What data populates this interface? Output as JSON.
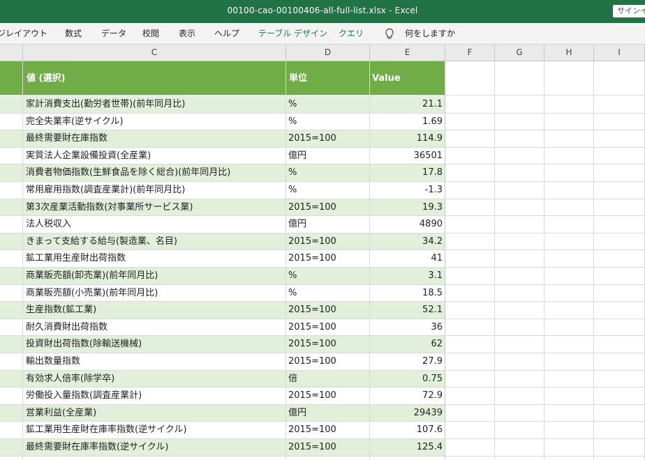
{
  "window": {
    "title": "00100-cao-00100406-all-full-list.xlsx  -  Excel",
    "sign_in": "サインイン"
  },
  "ribbon": {
    "tabs": [
      "ジレイアウト",
      "数式",
      "データ",
      "校閲",
      "表示",
      "ヘルプ",
      "テーブル デザイン",
      "クエリ"
    ],
    "tell_me": "何をしますか"
  },
  "columns": [
    "C",
    "D",
    "E",
    "F",
    "G",
    "H",
    "I"
  ],
  "table": {
    "headers": [
      "値 (選択)",
      "単位",
      "Value"
    ],
    "rows": [
      {
        "name": "家計消費支出(勤労者世帯)(前年同月比)",
        "unit": "%",
        "value": "21.1"
      },
      {
        "name": "完全失業率(逆サイクル)",
        "unit": "%",
        "value": "1.69"
      },
      {
        "name": "最終需要財在庫指数",
        "unit": "2015=100",
        "value": "114.9"
      },
      {
        "name": "実質法人企業設備投資(全産業)",
        "unit": "億円",
        "value": "36501"
      },
      {
        "name": "消費者物価指数(生鮮食品を除く総合)(前年同月比)",
        "unit": "%",
        "value": "17.8"
      },
      {
        "name": "常用雇用指数(調査産業計)(前年同月比)",
        "unit": "%",
        "value": "-1.3"
      },
      {
        "name": "第3次産業活動指数(対事業所サービス業)",
        "unit": "2015=100",
        "value": "19.3"
      },
      {
        "name": "法人税収入",
        "unit": "億円",
        "value": "4890"
      },
      {
        "name": "きまって支給する給与(製造業、名目)",
        "unit": "2015=100",
        "value": "34.2"
      },
      {
        "name": "鉱工業用生産財出荷指数",
        "unit": "2015=100",
        "value": "41"
      },
      {
        "name": "商業販売額(卸売業)(前年同月比)",
        "unit": "%",
        "value": "3.1"
      },
      {
        "name": "商業販売額(小売業)(前年同月比)",
        "unit": "%",
        "value": "18.5"
      },
      {
        "name": "生産指数(鉱工業)",
        "unit": "2015=100",
        "value": "52.1"
      },
      {
        "name": "耐久消費財出荷指数",
        "unit": "2015=100",
        "value": "36"
      },
      {
        "name": "投資財出荷指数(除輸送機械)",
        "unit": "2015=100",
        "value": "62"
      },
      {
        "name": "輸出数量指数",
        "unit": "2015=100",
        "value": "27.9"
      },
      {
        "name": "有効求人倍率(除学卒)",
        "unit": "倍",
        "value": "0.75"
      },
      {
        "name": "労働投入量指数(調査産業計)",
        "unit": "2015=100",
        "value": "72.9"
      },
      {
        "name": "営業利益(全産業)",
        "unit": "億円",
        "value": "29439"
      },
      {
        "name": "鉱工業用生産財在庫率指数(逆サイクル)",
        "unit": "2015=100",
        "value": "107.6"
      },
      {
        "name": "最終需要財在庫率指数(逆サイクル)",
        "unit": "2015=100",
        "value": "125.4"
      }
    ]
  },
  "colors": {
    "excel_green": "#217346",
    "header_fill": "#70ad47",
    "band_fill": "#e2efda",
    "header_text": "#ffffff"
  }
}
